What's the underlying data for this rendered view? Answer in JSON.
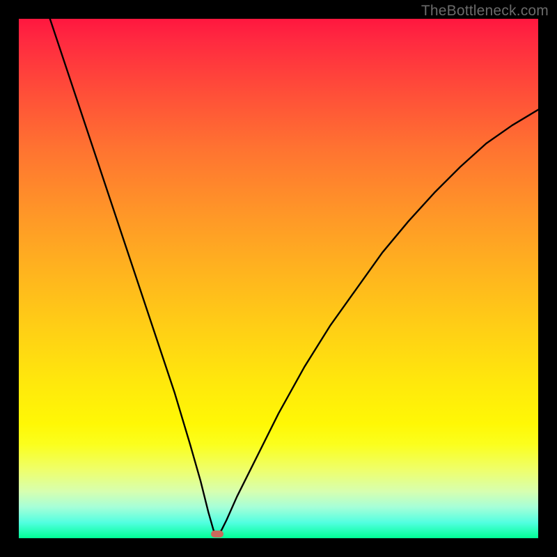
{
  "watermark": "TheBottleneck.com",
  "chart_data": {
    "type": "line",
    "title": "",
    "xlabel": "",
    "ylabel": "",
    "xlim": [
      0,
      100
    ],
    "ylim": [
      0,
      100
    ],
    "grid": false,
    "legend": false,
    "series": [
      {
        "name": "curve",
        "x": [
          6,
          10,
          15,
          20,
          25,
          30,
          33,
          35,
          36.5,
          37.5,
          38.2,
          39,
          40,
          42,
          45,
          50,
          55,
          60,
          65,
          70,
          75,
          80,
          85,
          90,
          95,
          100
        ],
        "y": [
          100,
          88,
          73,
          58,
          43,
          28,
          18,
          11,
          5,
          1.5,
          0.8,
          1.5,
          3.5,
          8,
          14,
          24,
          33,
          41,
          48,
          55,
          61,
          66.5,
          71.5,
          76,
          79.5,
          82.5
        ]
      }
    ],
    "marker": {
      "x": 38.2,
      "y": 0.8,
      "color": "#c96a5c"
    },
    "gradient_stops": [
      {
        "pos": 0,
        "color": "#ff173f"
      },
      {
        "pos": 50,
        "color": "#ffc01a"
      },
      {
        "pos": 80,
        "color": "#fcff10"
      },
      {
        "pos": 100,
        "color": "#00ff96"
      }
    ]
  }
}
